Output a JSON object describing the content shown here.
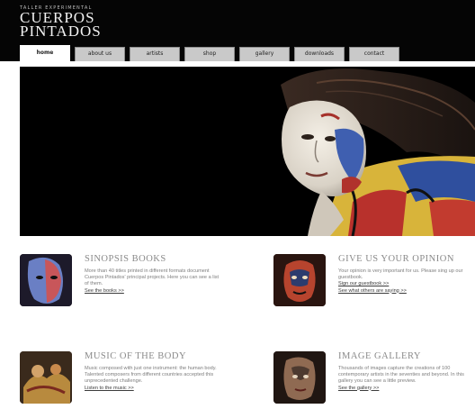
{
  "header": {
    "logo_tagline": "TALLER EXPERIMENTAL",
    "logo_line1": "CUERPOS",
    "logo_line2": "PINTADOS"
  },
  "nav": {
    "tabs": [
      {
        "label": "home",
        "active": true
      },
      {
        "label": "about us",
        "active": false
      },
      {
        "label": "artists",
        "active": false
      },
      {
        "label": "shop",
        "active": false
      },
      {
        "label": "gallery",
        "active": false
      },
      {
        "label": "downloads",
        "active": false
      },
      {
        "label": "contact",
        "active": false
      }
    ]
  },
  "features": {
    "synopsis": {
      "title": "SINOPSIS BOOKS",
      "body": "More than 40 titles printed in different formats document Cuerpos Pintados' principal projects. Here you can see a list of them.",
      "link": "See the books >>"
    },
    "opinion": {
      "title": "GIVE US YOUR OPINION",
      "body": "Your opinion is very important for us. Please sing up our guestbook.",
      "link1": "Sign our guestbook >>",
      "link2": "See what others are saying >>"
    },
    "music": {
      "title": "MUSIC OF THE BODY",
      "body": "Music composed with just one instrument: the human body. Talented composers from different countries accepted this unprecedented challenge.",
      "link": "Listen to the music >>"
    },
    "gallery": {
      "title": "IMAGE GALLERY",
      "body": "Thousands of images capture the creations of 100 contemporary artists in the seventies and beyond. In this gallery you can see a little preview.",
      "link": "See the gallery >>"
    }
  }
}
